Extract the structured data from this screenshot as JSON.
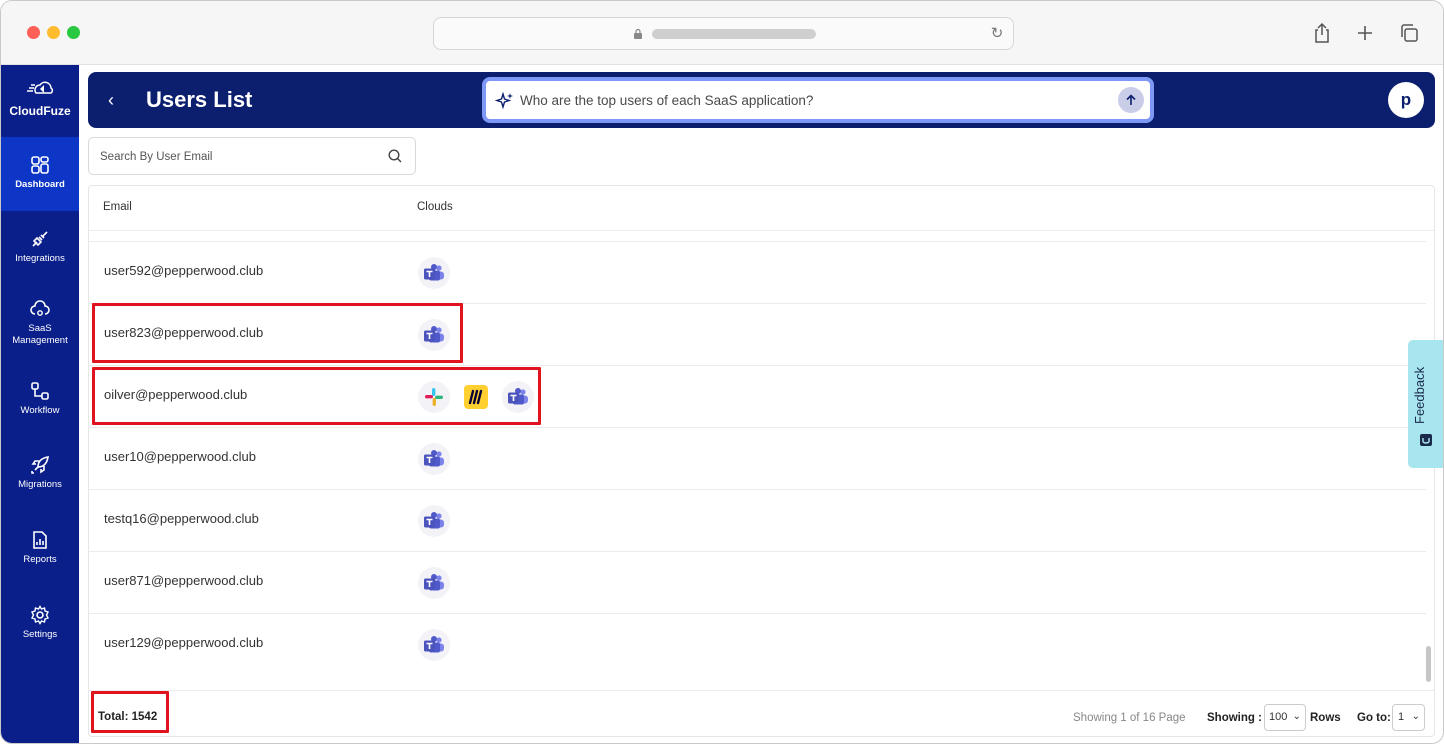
{
  "app": {
    "name": "CloudFuze"
  },
  "sidebar": {
    "items": [
      {
        "label": "Dashboard",
        "icon": "dashboard-icon"
      },
      {
        "label": "Integrations",
        "icon": "plug-icon"
      },
      {
        "label": "SaaS",
        "label2": "Management",
        "icon": "cloud-gear-icon"
      },
      {
        "label": "Workflow",
        "icon": "workflow-icon"
      },
      {
        "label": "Migrations",
        "icon": "rocket-icon"
      },
      {
        "label": "Reports",
        "icon": "report-icon"
      },
      {
        "label": "Settings",
        "icon": "gear-icon"
      }
    ]
  },
  "header": {
    "title": "Users List",
    "ai_placeholder": "Who are the top users of each SaaS application?",
    "avatar_initial": "p"
  },
  "search": {
    "placeholder": "Search By User Email"
  },
  "table": {
    "columns": [
      "Email",
      "Clouds"
    ],
    "rows": [
      {
        "email": "user592@pepperwood.club",
        "clouds": [
          "teams"
        ]
      },
      {
        "email": "user823@pepperwood.club",
        "clouds": [
          "teams"
        ]
      },
      {
        "email": "oilver@pepperwood.club",
        "clouds": [
          "slack",
          "miro",
          "teams"
        ]
      },
      {
        "email": "user10@pepperwood.club",
        "clouds": [
          "teams"
        ]
      },
      {
        "email": "testq16@pepperwood.club",
        "clouds": [
          "teams"
        ]
      },
      {
        "email": "user871@pepperwood.club",
        "clouds": [
          "teams"
        ]
      },
      {
        "email": "user129@pepperwood.club",
        "clouds": [
          "teams"
        ]
      }
    ]
  },
  "footer": {
    "total": "Total: 1542",
    "showing_page": "Showing 1 of 16 Page",
    "showing_label": "Showing :",
    "rows_value": "100",
    "rows_label": "Rows",
    "goto_label": "Go to:",
    "goto_value": "1"
  },
  "feedback": {
    "label": "Feedback"
  },
  "colors": {
    "sidebar": "#0b1f8a",
    "header": "#0b1f6e",
    "highlight": "#e0141e",
    "feedback": "#a8e6ef"
  }
}
